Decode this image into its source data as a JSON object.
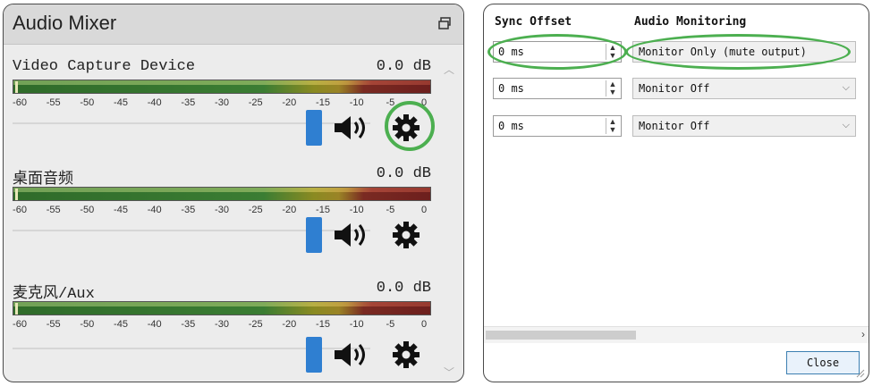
{
  "mixer": {
    "title": "Audio Mixer",
    "channels": [
      {
        "name": "Video Capture Device",
        "db": "0.0 dB",
        "highlighted_settings": true
      },
      {
        "name": "桌面音频",
        "db": "0.0 dB",
        "highlighted_settings": false
      },
      {
        "name": "麦克风/Aux",
        "db": "0.0 dB",
        "highlighted_settings": false
      }
    ],
    "ticks": [
      "-60",
      "-55",
      "-50",
      "-45",
      "-40",
      "-35",
      "-30",
      "-25",
      "-20",
      "-15",
      "-10",
      "-5",
      "0"
    ]
  },
  "sync": {
    "col_offset": "Sync Offset",
    "col_monitoring": "Audio Monitoring",
    "rows": [
      {
        "offset": "0 ms",
        "monitoring": "Monitor Only (mute output)",
        "highlighted": true
      },
      {
        "offset": "0 ms",
        "monitoring": "Monitor Off",
        "highlighted": false
      },
      {
        "offset": "0 ms",
        "monitoring": "Monitor Off",
        "highlighted": false
      }
    ],
    "close_label": "Close"
  },
  "icons": {
    "dock": "dock-icon",
    "speaker": "speaker-icon",
    "gear": "gear-icon",
    "spinner": "spinner-icon",
    "chevron": "chevron-down-icon"
  },
  "colors": {
    "accent_highlight": "#4caf50",
    "volume_handle": "#2f7fd1",
    "meter_green": "#3b7d33",
    "meter_yellow": "#9a8426",
    "meter_red": "#6d1f1d"
  }
}
